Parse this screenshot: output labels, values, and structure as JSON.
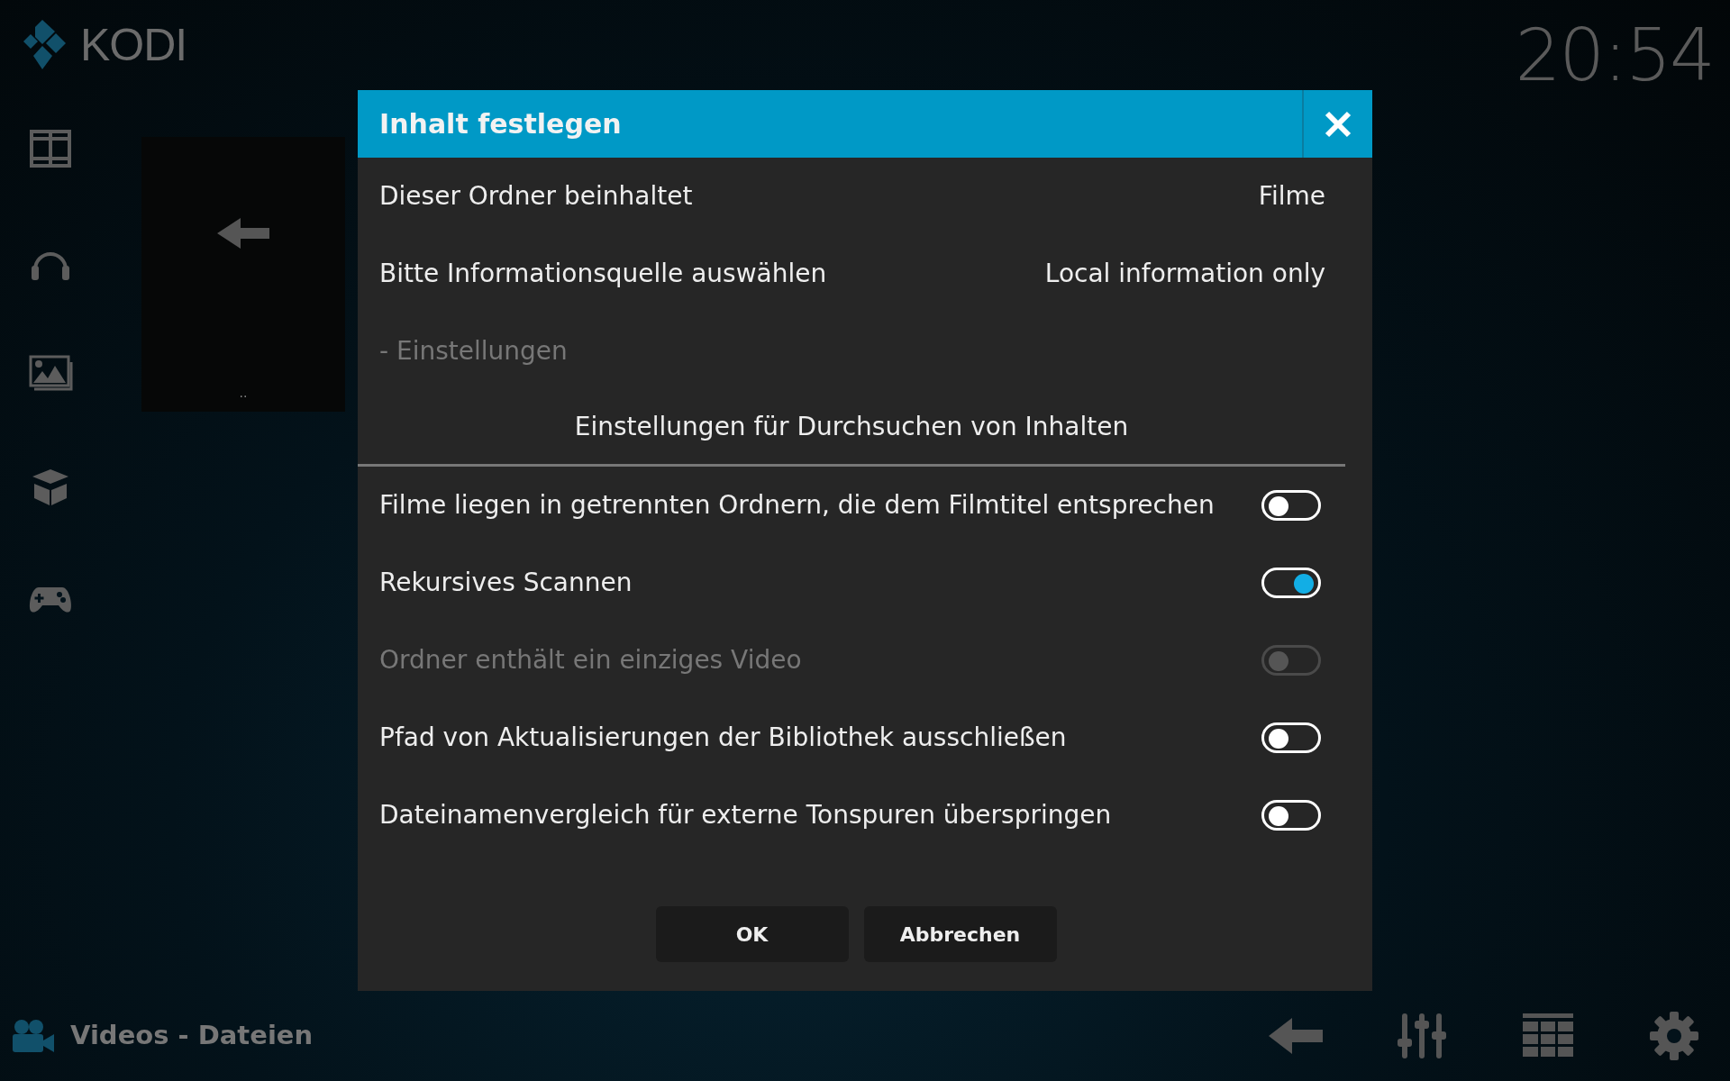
{
  "app": {
    "logo_text": "KODI",
    "clock": "20:54"
  },
  "file_tile": {
    "label": ".."
  },
  "footer": {
    "title": "Videos - Dateien"
  },
  "dialog": {
    "title": "Inhalt festlegen",
    "rows": [
      {
        "kind": "value",
        "label": "Dieser Ordner beinhaltet",
        "value": "Filme"
      },
      {
        "kind": "value",
        "label": "Bitte Informationsquelle auswählen",
        "value": "Local information only"
      },
      {
        "kind": "header",
        "label": "- Einstellungen"
      },
      {
        "kind": "centered",
        "label": "Einstellungen für Durchsuchen von Inhalten"
      }
    ],
    "toggles": [
      {
        "label": "Filme liegen in getrennten Ordnern, die dem Filmtitel entsprechen",
        "on": false,
        "disabled": false
      },
      {
        "label": "Rekursives Scannen",
        "on": true,
        "disabled": false
      },
      {
        "label": "Ordner enthält ein einziges Video",
        "on": false,
        "disabled": true
      },
      {
        "label": "Pfad von Aktualisierungen der Bibliothek ausschließen",
        "on": false,
        "disabled": false
      },
      {
        "label": "Dateinamenvergleich für externe Tonspuren überspringen",
        "on": false,
        "disabled": false
      }
    ],
    "buttons": [
      "OK",
      "Abbrechen"
    ]
  }
}
